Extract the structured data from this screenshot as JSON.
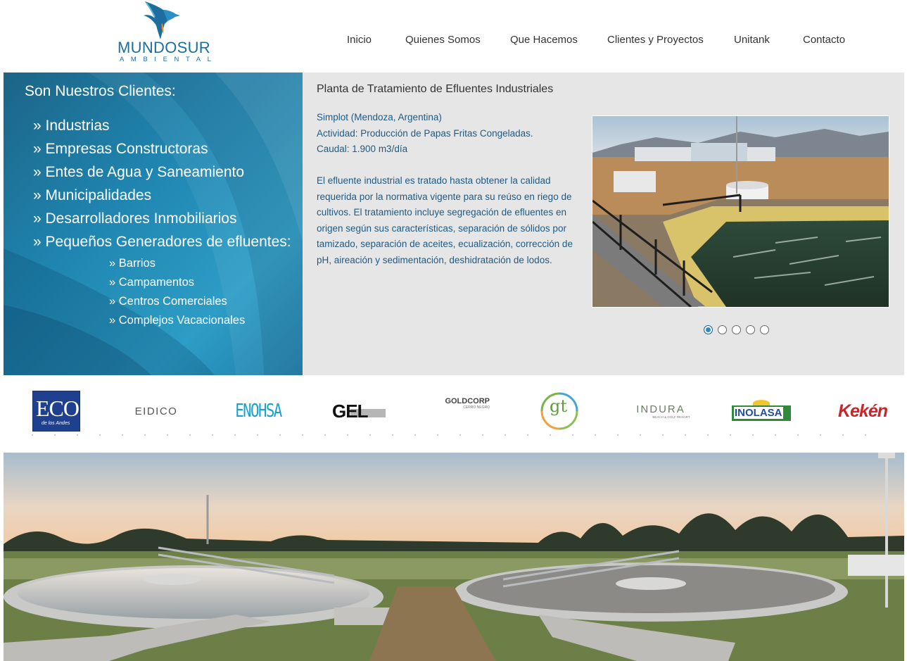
{
  "brand": {
    "name": "MUNDOSUR",
    "tagline": "AMBIENTAL"
  },
  "nav": [
    "Inicio",
    "Quienes Somos",
    "Que Hacemos",
    "Clientes y Proyectos",
    "Unitank",
    "Contacto"
  ],
  "clients": {
    "title": "Son Nuestros Clientes:",
    "items": [
      "» Industrias",
      "» Empresas Constructoras",
      "» Entes de Agua y Saneamiento",
      "» Municipalidades",
      "» Desarrolladores Inmobiliarios",
      "» Pequeños Generadores de efluentes:"
    ],
    "subitems": [
      "» Barrios",
      "» Campamentos",
      "» Centros Comerciales",
      "» Complejos Vacacionales"
    ]
  },
  "project": {
    "title": "Planta de Tratamiento de Efluentes Industriales",
    "client": "Simplot (Mendoza, Argentina)",
    "activity": "Actividad: Producción de Papas Fritas Congeladas.",
    "flow": "Caudal: 1.900 m3/día",
    "description": "El efluente industrial es tratado hasta obtener la calidad requerida por la normativa vigente para su reúso en riego de cultivos. El tratamiento incluye segregación de efluentes en origen según sus características, separación de sólidos por tamizado, separación de aceites, ecualización, corrección de pH, aireación y sedimentación, deshidratación de lodos."
  },
  "slider": {
    "active_index": 0,
    "count": 5
  },
  "client_logos": {
    "eco": {
      "main": "ECO",
      "sub": "de los Andes"
    },
    "eidico": "EIDICO",
    "enohsa": "ENOHSA",
    "gel": "GEL",
    "goldcorp": {
      "main": "GOLDCORP",
      "sub": "CERRO NEGRO"
    },
    "gt": "gt",
    "indura": {
      "main": "INDURA",
      "sub": "BEACH & GOLF RESORT"
    },
    "inolasa": "INOLASA",
    "keken": "Kekén"
  },
  "colors": {
    "brand_blue": "#1b6e9e",
    "panel_blue": "#1f85b0",
    "text_blue": "#1d5a85",
    "panel_gray": "#e6e6e6",
    "dot_active": "#2f86c9"
  }
}
